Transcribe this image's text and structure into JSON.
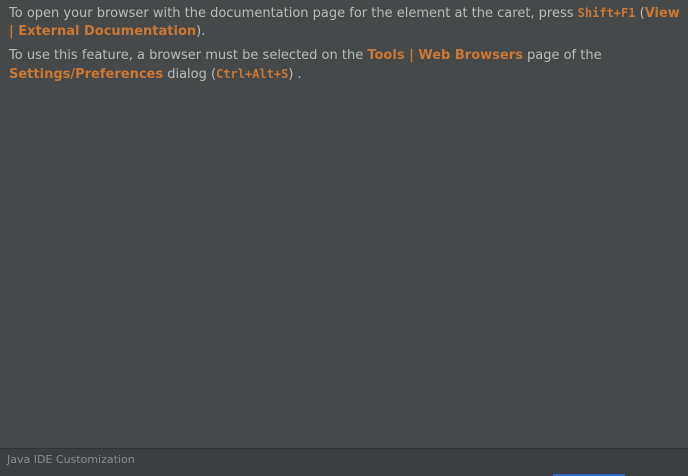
{
  "doc": {
    "p1": {
      "t1": "To open your browser with the documentation page for the element at the caret, press ",
      "shortcut": "Shift+F1",
      "t2": " (",
      "menu": "View | External Documentation",
      "t3": ")."
    },
    "p2": {
      "t1": "To use this feature, a browser must be selected on the ",
      "page": "Tools | Web Browsers",
      "t2": " page of the ",
      "dialog": "Settings/Preferences",
      "t3": " dialog (",
      "shortcut": "Ctrl+Alt+S",
      "t4": ") ."
    }
  },
  "footer": {
    "label": "Java IDE Customization"
  },
  "colors": {
    "background": "#45494a",
    "text": "#bbbbbb",
    "accent": "#cc7832",
    "footer_bg": "#3c3f41",
    "footer_text": "#8c8c8c",
    "footer_bar": "#2f65ca"
  }
}
